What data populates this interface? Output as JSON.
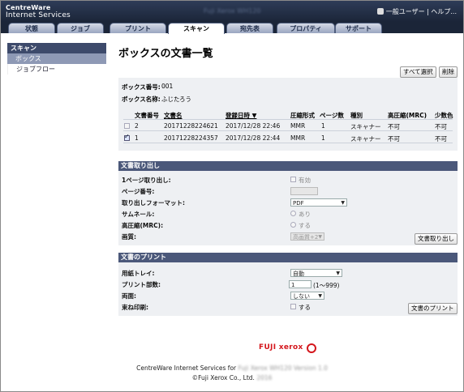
{
  "header": {
    "brand_line1": "CentreWare",
    "brand_line2": "Internet Services",
    "device_name": "Fuji Xerox WH120",
    "user_menu": "一般ユーザー | ヘルプ..."
  },
  "tabs": [
    {
      "label": "状態"
    },
    {
      "label": "ジョブ"
    },
    {
      "label": "プリント"
    },
    {
      "label": "スキャン"
    },
    {
      "label": "宛先表"
    },
    {
      "label": "プロパティ"
    },
    {
      "label": "サポート"
    }
  ],
  "sidebar": {
    "section": "スキャン",
    "items": [
      {
        "label": "ボックス"
      },
      {
        "label": "ジョブフロー"
      }
    ]
  },
  "main": {
    "title": "ボックスの文書一覧",
    "select_all_button": "すべて選択",
    "delete_button": "削除",
    "box_number_label": "ボックス番号:",
    "box_number": "001",
    "box_name_label": "ボックス名称:",
    "box_name": "ふじたろう",
    "columns": [
      "文書番号",
      "文書名",
      "登録日時 ▼",
      "圧縮形式",
      "ページ数",
      "種別",
      "高圧縮(MRC)",
      "少数色"
    ],
    "rows": [
      {
        "checked": false,
        "num": "2",
        "name": "20171228224621",
        "date": "2017/12/28 22:46",
        "format": "MMR",
        "pages": "1",
        "type": "スキャナー",
        "mrc": "不可",
        "few_colors": "不可"
      },
      {
        "checked": true,
        "num": "1",
        "name": "20171228224357",
        "date": "2017/12/28 22:44",
        "format": "MMR",
        "pages": "1",
        "type": "スキャナー",
        "mrc": "不可",
        "few_colors": "不可"
      }
    ]
  },
  "retrieve": {
    "header": "文書取り出し",
    "single_page_label": "1ページ取り出し:",
    "single_page_value": "有効",
    "page_number_label": "ページ番号:",
    "page_number_value": "",
    "format_label": "取り出しフォーマット:",
    "format_value": "PDF",
    "thumbnail_label": "サムネール:",
    "thumbnail_value": "あり",
    "mrc_label": "高圧縮(MRC):",
    "mrc_value": "する",
    "quality_label": "画質:",
    "quality_value": "高画質+2",
    "button": "文書取り出し"
  },
  "print": {
    "header": "文書のプリント",
    "tray_label": "用紙トレイ:",
    "tray_value": "自動",
    "copies_label": "プリント部数:",
    "copies_value": "1",
    "copies_range": "(1〜999)",
    "duplex_label": "両面:",
    "duplex_value": "しない",
    "collate_label": "束ね印刷:",
    "collate_value": "する",
    "button": "文書のプリント"
  },
  "footer": {
    "logo": "FUJI xerox",
    "line1_prefix": "CentreWare Internet Services for",
    "line1_device": "Fuji Xerox WH120 Version 1.0",
    "line2_prefix": "©Fuji Xerox Co., Ltd.",
    "line2_year": "2016"
  }
}
